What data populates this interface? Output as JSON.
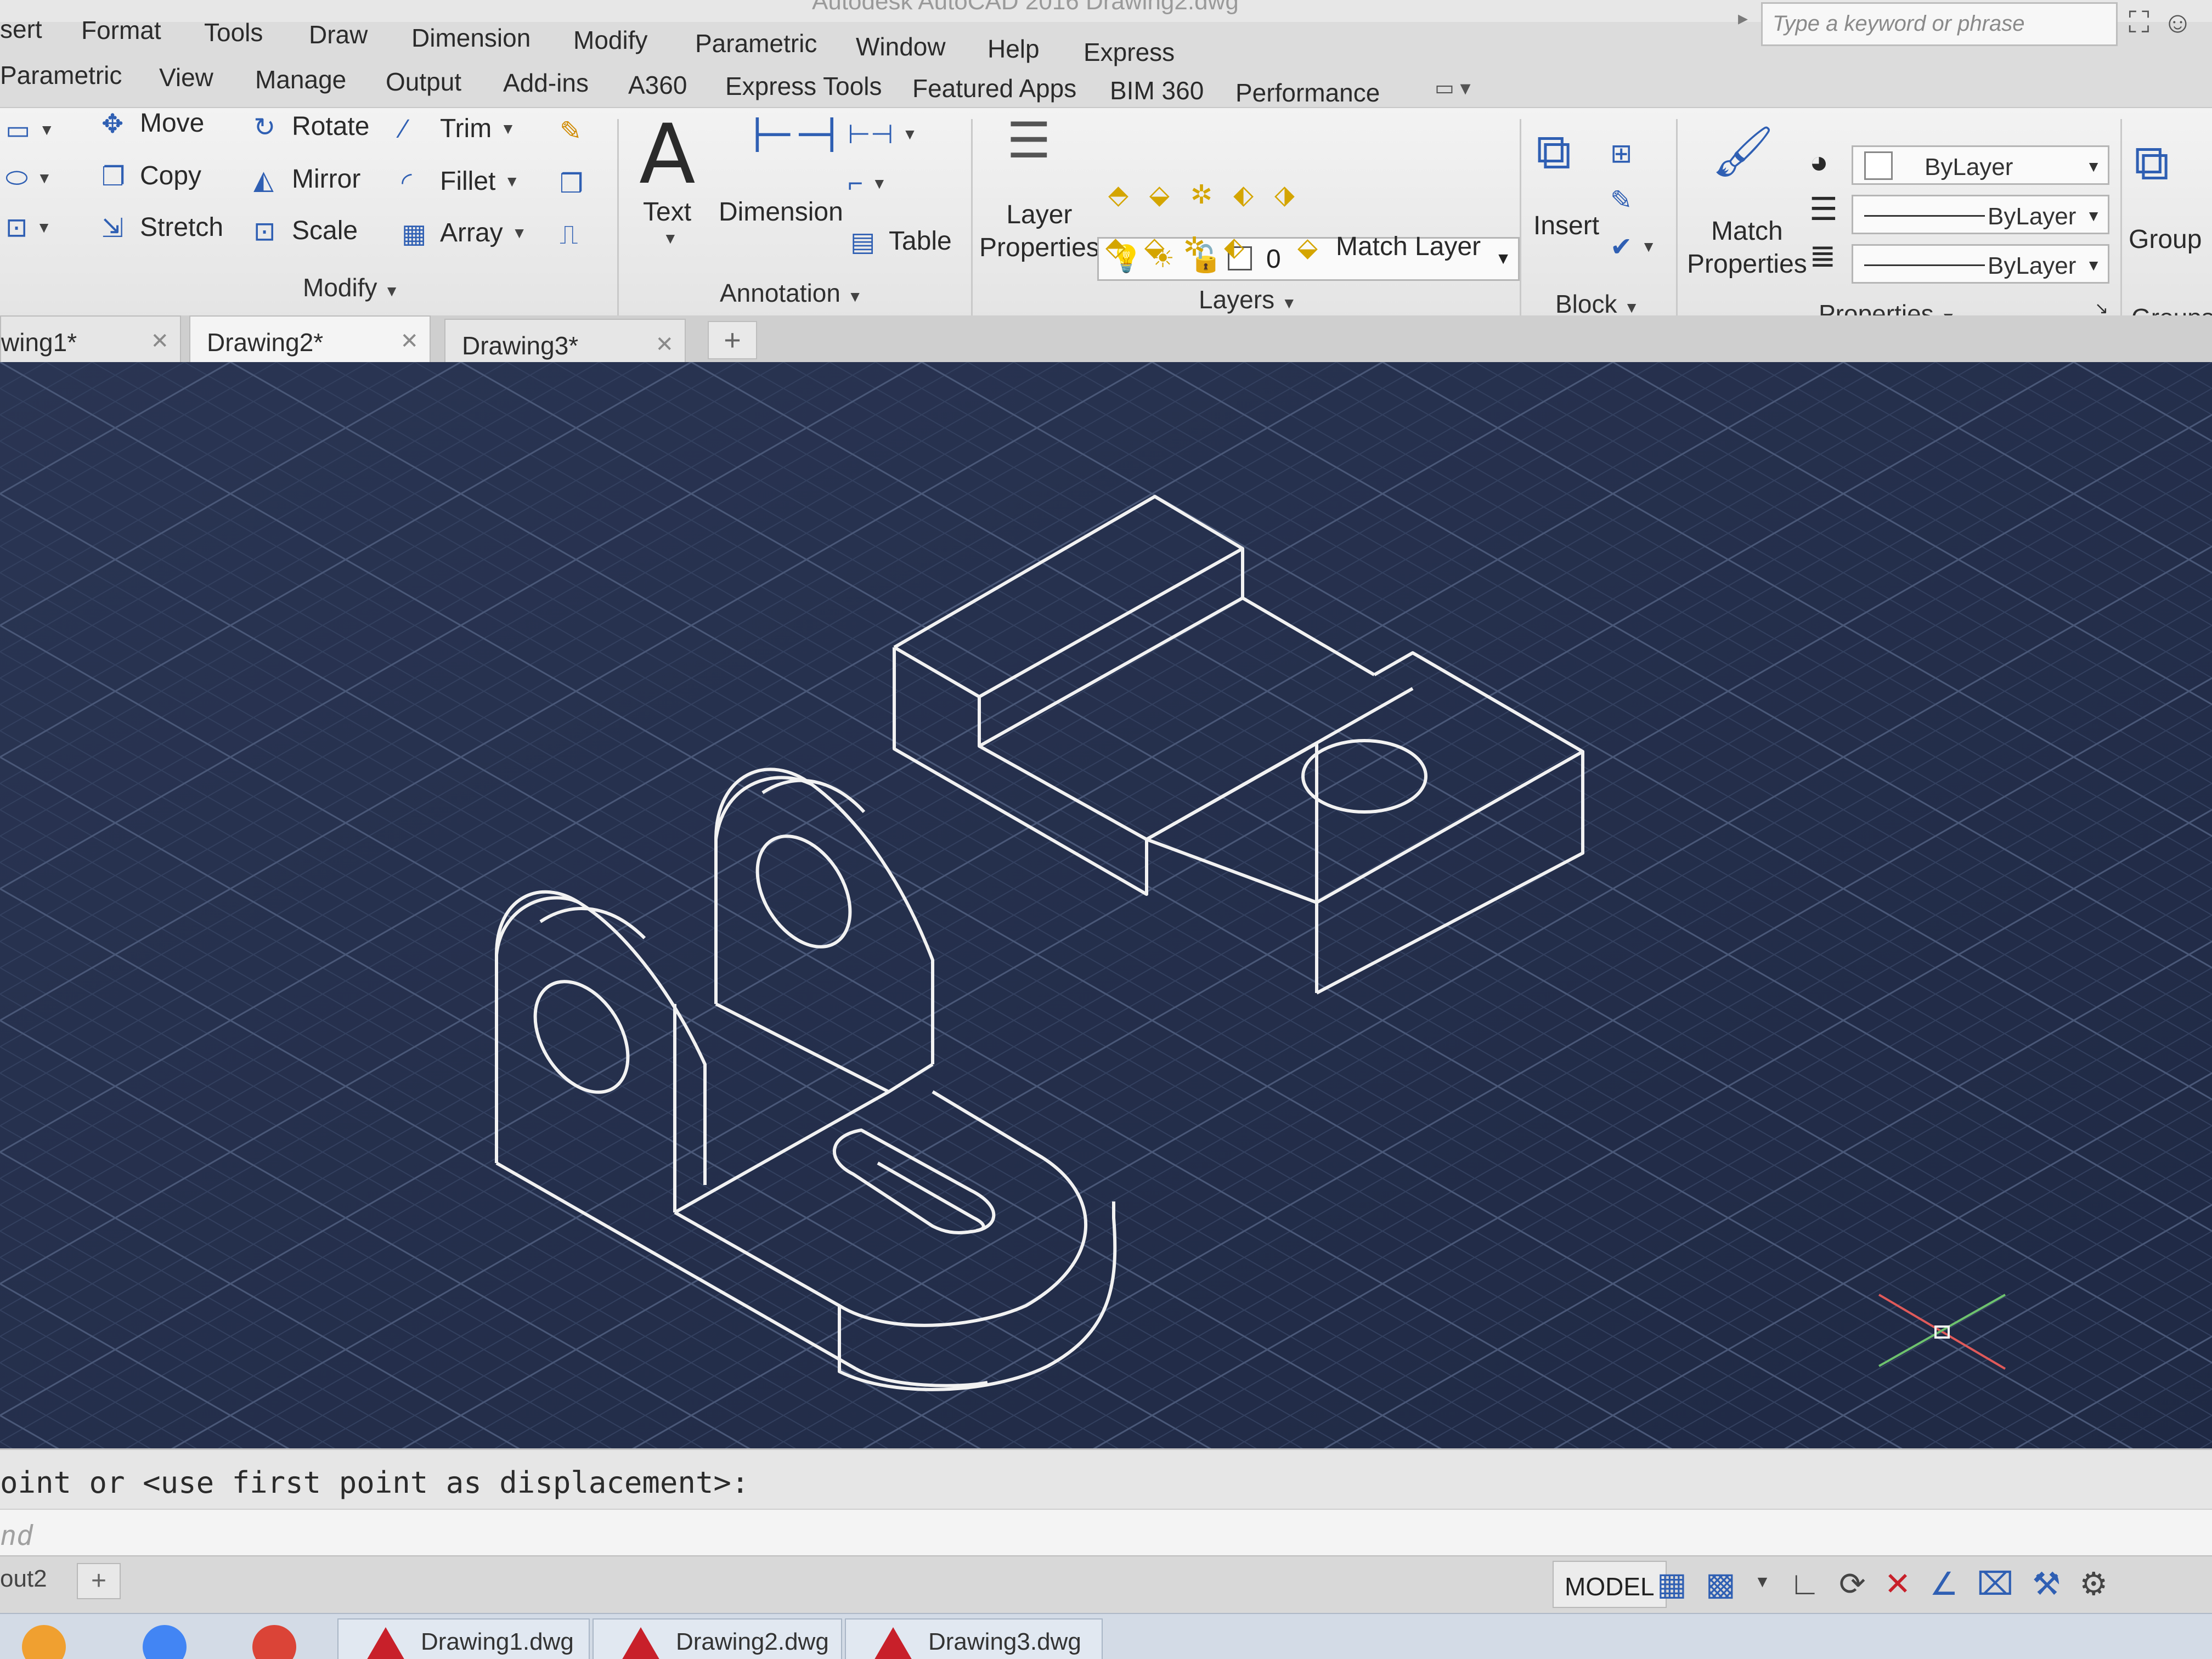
{
  "title": {
    "text": "Autodesk AutoCAD 2016   Drawing2.dwg"
  },
  "search": {
    "placeholder": "Type a keyword or phrase"
  },
  "menu": [
    "sert",
    "Format",
    "Tools",
    "Draw",
    "Dimension",
    "Modify",
    "Parametric",
    "Window",
    "Help",
    "Express"
  ],
  "ribbon_tabs": [
    "Parametric",
    "View",
    "Manage",
    "Output",
    "Add-ins",
    "A360",
    "Express Tools",
    "Featured Apps",
    "BIM 360",
    "Performance"
  ],
  "modify": {
    "move": "Move",
    "copy": "Copy",
    "stretch": "Stretch",
    "rotate": "Rotate",
    "mirror": "Mirror",
    "scale": "Scale",
    "trim": "Trim",
    "fillet": "Fillet",
    "array": "Array",
    "panel": "Modify"
  },
  "annotation": {
    "text": "Text",
    "dimension": "Dimension",
    "table": "Table",
    "panel": "Annotation"
  },
  "layers": {
    "layer_properties_1": "Layer",
    "layer_properties_2": "Properties",
    "current_layer": "0",
    "match_layer": "Match Layer",
    "panel": "Layers"
  },
  "block": {
    "insert": "Insert",
    "panel": "Block"
  },
  "properties": {
    "match_1": "Match",
    "match_2": "Properties",
    "color": "ByLayer",
    "linetype": "ByLayer",
    "lineweight": "ByLayer",
    "panel": "Properties"
  },
  "groups": {
    "group": "Group",
    "panel": "Groups"
  },
  "doc_tabs": [
    "wing1*",
    "Drawing2*",
    "Drawing3*"
  ],
  "command": {
    "history": "oint or <use first point as displacement>:",
    "input": "nd"
  },
  "status": {
    "layout_tab": "out2",
    "model": "MODEL"
  },
  "taskbar": [
    "Drawing1.dwg",
    "Drawing2.dwg",
    "Drawing3.dwg"
  ],
  "colors": {
    "canvas": "#232e4b",
    "grid": "#33405f",
    "linework": "#f2f2f2",
    "accent": "#2f5fb3",
    "autocad_red": "#c8202a"
  },
  "icons": [
    "search-icon",
    "binoculars-icon",
    "user-icon",
    "move-icon",
    "copy-icon",
    "stretch-icon",
    "rotate-icon",
    "mirror-icon",
    "scale-icon",
    "trim-icon",
    "fillet-icon",
    "array-icon",
    "text-icon",
    "dimension-icon",
    "table-icon",
    "layer-properties-icon",
    "insert-icon",
    "match-properties-icon",
    "group-icon",
    "ucs-icon"
  ]
}
